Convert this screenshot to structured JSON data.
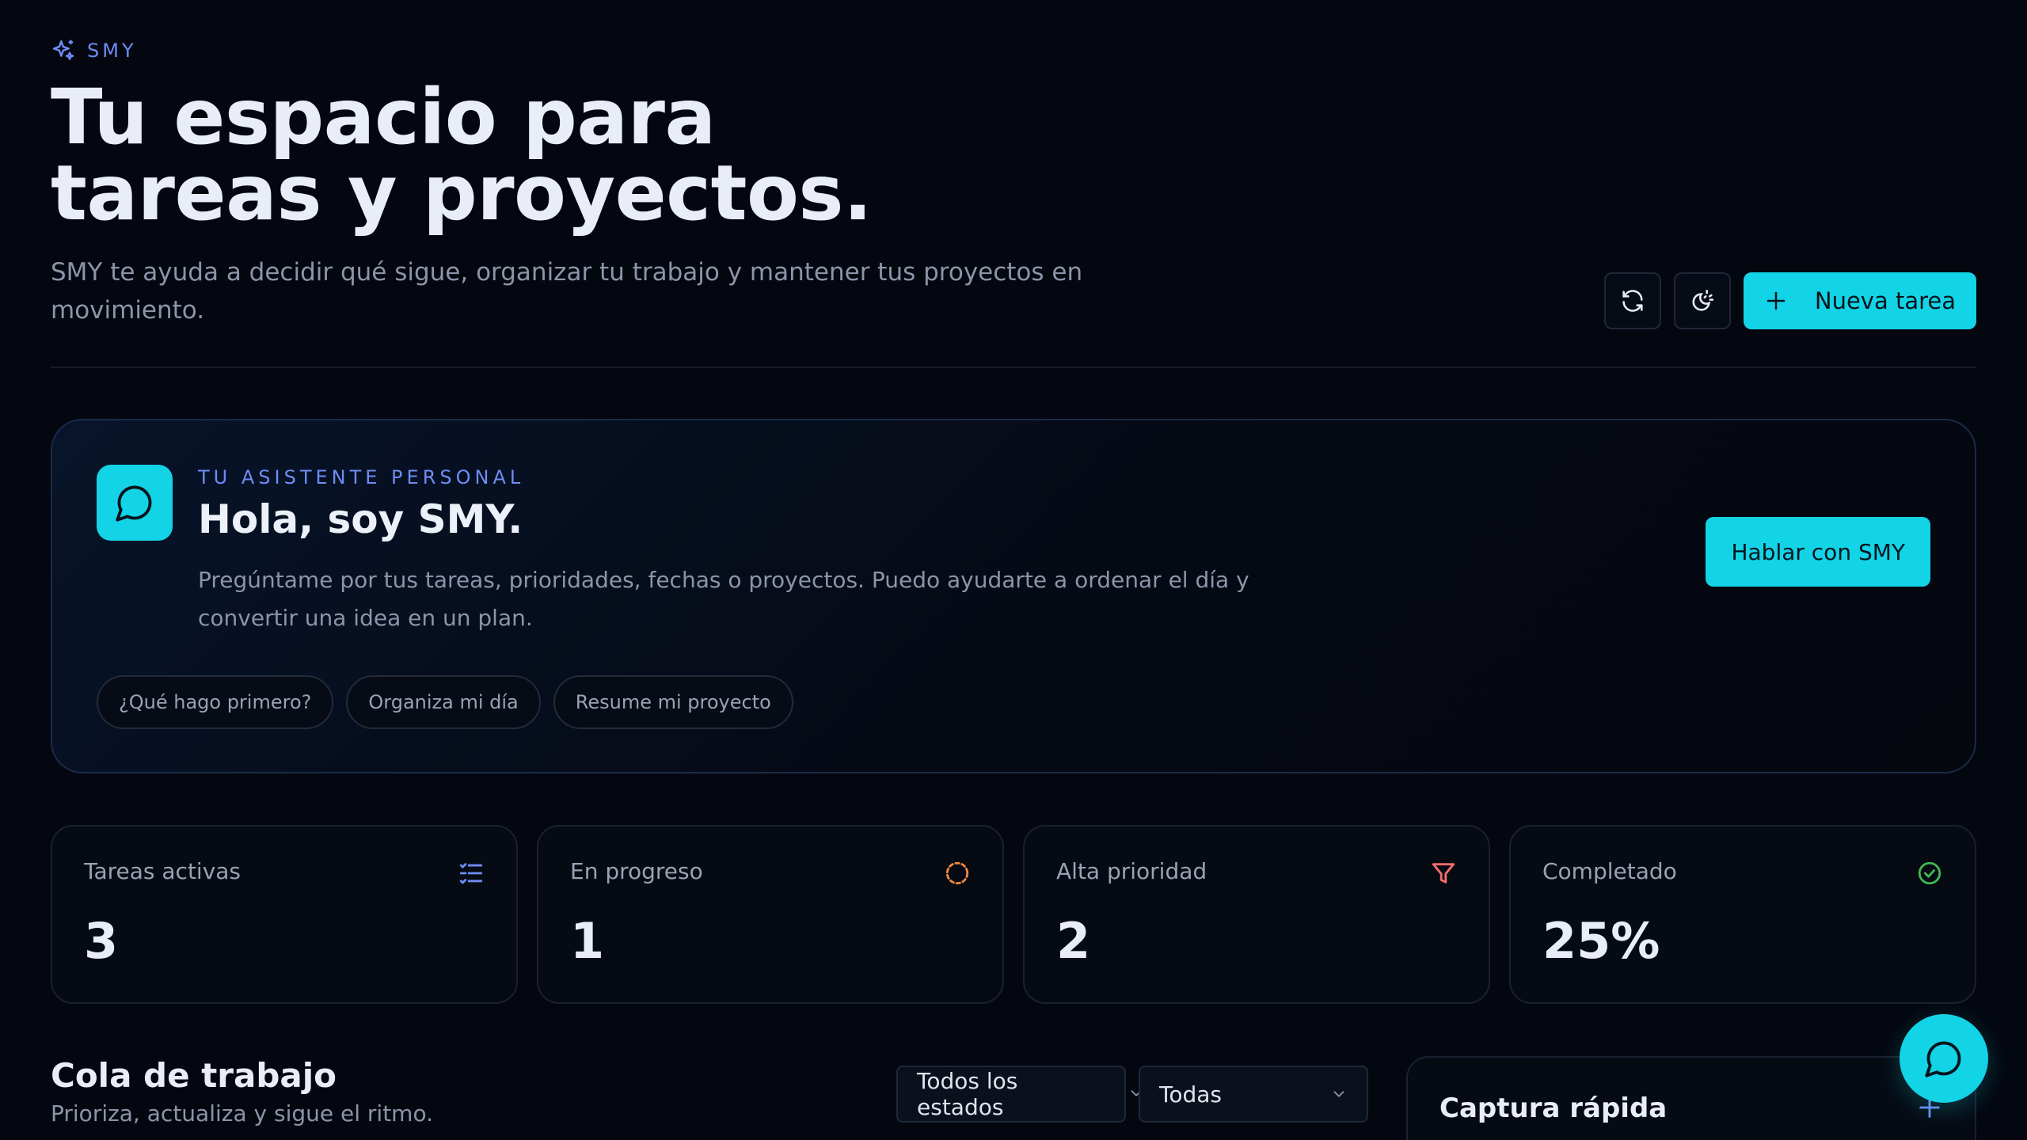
{
  "brand": {
    "label": "SMY",
    "icon": "sparkles-icon"
  },
  "hero": {
    "title_line1": "Tu espacio para",
    "title_line2": "tareas y proyectos.",
    "subtitle": "SMY te ayuda a decidir qué sigue, organizar tu trabajo y mantener tus proyectos en movimiento."
  },
  "header_actions": {
    "refresh_icon": "refresh-icon",
    "theme_icon": "theme-toggle-icon",
    "new_task_label": "Nueva tarea"
  },
  "assistant": {
    "eyebrow": "TU ASISTENTE PERSONAL",
    "title": "Hola, soy SMY.",
    "description": "Pregúntame por tus tareas, prioridades, fechas o proyectos. Puedo ayudarte a ordenar el día y convertir una idea en un plan.",
    "cta_label": "Hablar con SMY",
    "suggestions": [
      "¿Qué hago primero?",
      "Organiza mi día",
      "Resume mi proyecto"
    ]
  },
  "stats": [
    {
      "label": "Tareas activas",
      "value": "3",
      "icon": "checklist-icon",
      "color": "#6f8cf5"
    },
    {
      "label": "En progreso",
      "value": "1",
      "icon": "progress-circle-icon",
      "color": "#f0883e"
    },
    {
      "label": "Alta prioridad",
      "value": "2",
      "icon": "filter-icon",
      "color": "#f26d6d"
    },
    {
      "label": "Completado",
      "value": "25%",
      "icon": "check-circle-icon",
      "color": "#3fb950"
    }
  ],
  "queue": {
    "title": "Cola de trabajo",
    "subtitle": "Prioriza, actualiza y sigue el ritmo.",
    "status_filter": "Todos los estados",
    "priority_filter": "Todas"
  },
  "capture": {
    "title": "Captura rápida"
  },
  "colors": {
    "accent": "#13d3e6",
    "brand": "#6f8cf5",
    "background": "#04070f"
  }
}
